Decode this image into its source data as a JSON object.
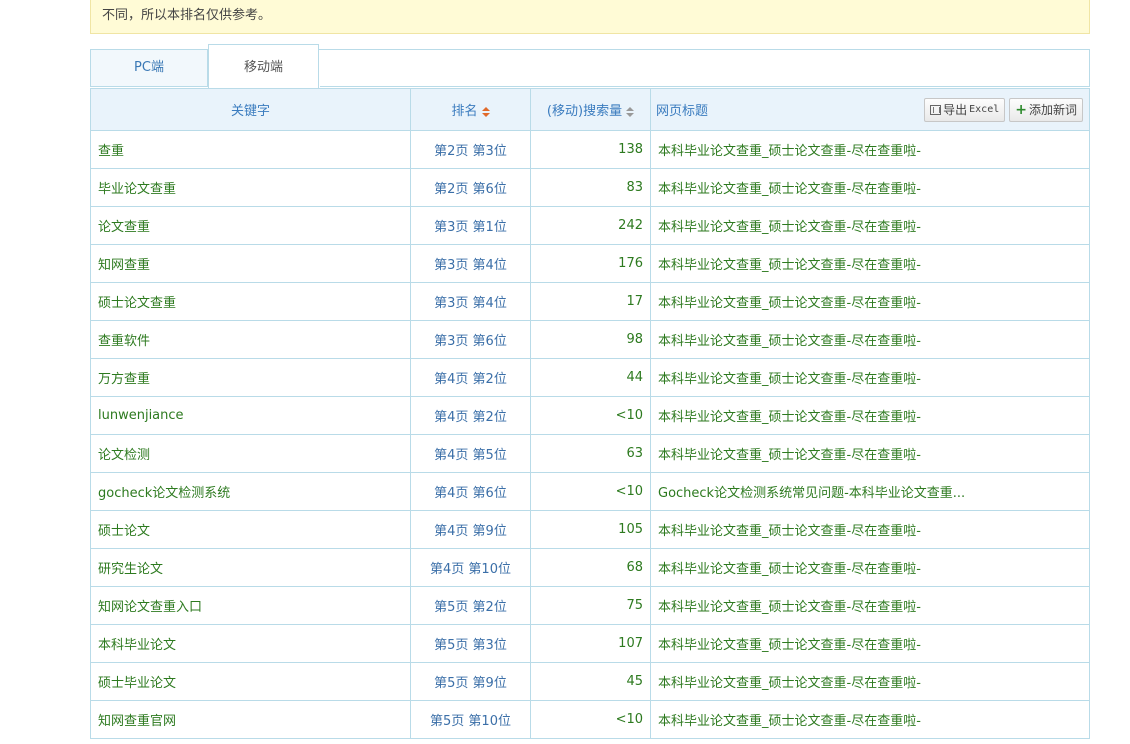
{
  "notice": {
    "text": "不同，所以本排名仅供参考。"
  },
  "tabs": [
    {
      "label": "PC端",
      "active": false
    },
    {
      "label": "移动端",
      "active": true
    }
  ],
  "table": {
    "headers": {
      "keyword": "关键字",
      "rank": "排名",
      "volume": "(移动)搜索量",
      "title": "网页标题"
    },
    "export_label": "导出",
    "export_suffix": "Excel",
    "add_label": "添加新词",
    "rows": [
      {
        "keyword": "查重",
        "rank": "第2页 第3位",
        "volume": "138",
        "title": "本科毕业论文查重_硕士论文查重-尽在查重啦-"
      },
      {
        "keyword": "毕业论文查重",
        "rank": "第2页 第6位",
        "volume": "83",
        "title": "本科毕业论文查重_硕士论文查重-尽在查重啦-"
      },
      {
        "keyword": "论文查重",
        "rank": "第3页 第1位",
        "volume": "242",
        "title": "本科毕业论文查重_硕士论文查重-尽在查重啦-"
      },
      {
        "keyword": "知网查重",
        "rank": "第3页 第4位",
        "volume": "176",
        "title": "本科毕业论文查重_硕士论文查重-尽在查重啦-"
      },
      {
        "keyword": "硕士论文查重",
        "rank": "第3页 第4位",
        "volume": "17",
        "title": "本科毕业论文查重_硕士论文查重-尽在查重啦-"
      },
      {
        "keyword": "查重软件",
        "rank": "第3页 第6位",
        "volume": "98",
        "title": "本科毕业论文查重_硕士论文查重-尽在查重啦-"
      },
      {
        "keyword": "万方查重",
        "rank": "第4页 第2位",
        "volume": "44",
        "title": "本科毕业论文查重_硕士论文查重-尽在查重啦-"
      },
      {
        "keyword": "lunwenjiance",
        "rank": "第4页 第2位",
        "volume": "<10",
        "title": "本科毕业论文查重_硕士论文查重-尽在查重啦-"
      },
      {
        "keyword": "论文检测",
        "rank": "第4页 第5位",
        "volume": "63",
        "title": "本科毕业论文查重_硕士论文查重-尽在查重啦-"
      },
      {
        "keyword": "gocheck论文检测系统",
        "rank": "第4页 第6位",
        "volume": "<10",
        "title": "Gocheck论文检测系统常见问题-本科毕业论文查重..."
      },
      {
        "keyword": "硕士论文",
        "rank": "第4页 第9位",
        "volume": "105",
        "title": "本科毕业论文查重_硕士论文查重-尽在查重啦-"
      },
      {
        "keyword": "研究生论文",
        "rank": "第4页 第10位",
        "volume": "68",
        "title": "本科毕业论文查重_硕士论文查重-尽在查重啦-"
      },
      {
        "keyword": "知网论文查重入口",
        "rank": "第5页 第2位",
        "volume": "75",
        "title": "本科毕业论文查重_硕士论文查重-尽在查重啦-"
      },
      {
        "keyword": "本科毕业论文",
        "rank": "第5页 第3位",
        "volume": "107",
        "title": "本科毕业论文查重_硕士论文查重-尽在查重啦-"
      },
      {
        "keyword": "硕士毕业论文",
        "rank": "第5页 第9位",
        "volume": "45",
        "title": "本科毕业论文查重_硕士论文查重-尽在查重啦-"
      },
      {
        "keyword": "知网查重官网",
        "rank": "第5页 第10位",
        "volume": "<10",
        "title": "本科毕业论文查重_硕士论文查重-尽在查重啦-"
      }
    ]
  }
}
